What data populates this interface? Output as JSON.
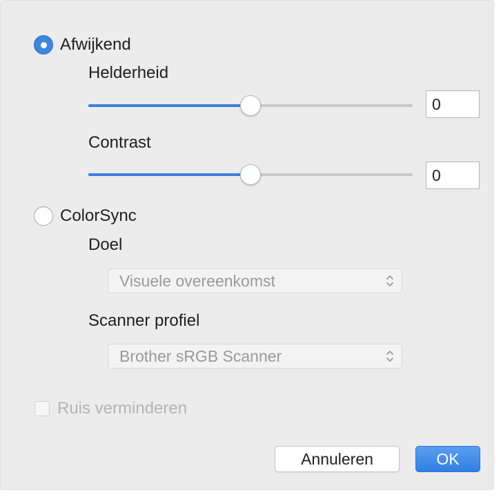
{
  "custom": {
    "label": "Afwijkend",
    "selected": true,
    "brightness": {
      "label": "Helderheid",
      "value": "0",
      "slider_fraction": 0.5
    },
    "contrast": {
      "label": "Contrast",
      "value": "0",
      "slider_fraction": 0.5
    }
  },
  "colorsync": {
    "label": "ColorSync",
    "selected": false,
    "goal": {
      "label": "Doel",
      "selected_option": "Visuele overeenkomst"
    },
    "scanner_profile": {
      "label": "Scanner profiel",
      "selected_option": "Brother sRGB Scanner"
    }
  },
  "noise_reduction": {
    "label": "Ruis verminderen",
    "checked": false,
    "enabled": false
  },
  "buttons": {
    "cancel_label": "Annuleren",
    "ok_label": "OK"
  },
  "colors": {
    "accent": "#3f86e0",
    "window_bg": "#ececec",
    "disabled_text": "#b4b4b4"
  }
}
